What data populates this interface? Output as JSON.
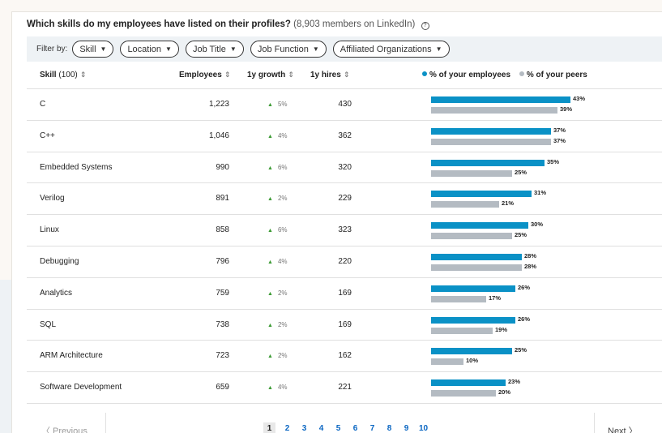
{
  "title": {
    "question": "Which skills do my employees have listed on their profiles?",
    "subtitle": "(8,903 members on LinkedIn)",
    "help_icon": "question-circle-icon"
  },
  "filters": {
    "label": "Filter by:",
    "pills": [
      "Skill",
      "Location",
      "Job Title",
      "Job Function",
      "Affiliated Organizations"
    ]
  },
  "columns": {
    "skill": "Skill",
    "skill_count": "(100)",
    "employees": "Employees",
    "growth": "1y growth",
    "hires": "1y hires",
    "legend_employees": "% of your employees",
    "legend_peers": "% of your peers"
  },
  "colors": {
    "employees_bar": "#0a91c6",
    "peers_bar": "#b4bbc2",
    "growth_up": "#3d9b35",
    "link": "#0a66c2"
  },
  "rows": [
    {
      "skill": "C",
      "employees": "1,223",
      "growth": "5%",
      "hires": "430",
      "emp_pct": 43,
      "peer_pct": 39,
      "emp_label": "43%",
      "peer_label": "39%"
    },
    {
      "skill": "C++",
      "employees": "1,046",
      "growth": "4%",
      "hires": "362",
      "emp_pct": 37,
      "peer_pct": 37,
      "emp_label": "37%",
      "peer_label": "37%"
    },
    {
      "skill": "Embedded Systems",
      "employees": "990",
      "growth": "6%",
      "hires": "320",
      "emp_pct": 35,
      "peer_pct": 25,
      "emp_label": "35%",
      "peer_label": "25%"
    },
    {
      "skill": "Verilog",
      "employees": "891",
      "growth": "2%",
      "hires": "229",
      "emp_pct": 31,
      "peer_pct": 21,
      "emp_label": "31%",
      "peer_label": "21%"
    },
    {
      "skill": "Linux",
      "employees": "858",
      "growth": "6%",
      "hires": "323",
      "emp_pct": 30,
      "peer_pct": 25,
      "emp_label": "30%",
      "peer_label": "25%"
    },
    {
      "skill": "Debugging",
      "employees": "796",
      "growth": "4%",
      "hires": "220",
      "emp_pct": 28,
      "peer_pct": 28,
      "emp_label": "28%",
      "peer_label": "28%"
    },
    {
      "skill": "Analytics",
      "employees": "759",
      "growth": "2%",
      "hires": "169",
      "emp_pct": 26,
      "peer_pct": 17,
      "emp_label": "26%",
      "peer_label": "17%"
    },
    {
      "skill": "SQL",
      "employees": "738",
      "growth": "2%",
      "hires": "169",
      "emp_pct": 26,
      "peer_pct": 19,
      "emp_label": "26%",
      "peer_label": "19%"
    },
    {
      "skill": "ARM Architecture",
      "employees": "723",
      "growth": "2%",
      "hires": "162",
      "emp_pct": 25,
      "peer_pct": 10,
      "emp_label": "25%",
      "peer_label": "10%"
    },
    {
      "skill": "Software Development",
      "employees": "659",
      "growth": "4%",
      "hires": "221",
      "emp_pct": 23,
      "peer_pct": 20,
      "emp_label": "23%",
      "peer_label": "20%"
    }
  ],
  "pagination": {
    "prev": "〈 Previous",
    "next": "Next 〉",
    "current": "1",
    "pages": [
      "1",
      "2",
      "3",
      "4",
      "5",
      "6",
      "7",
      "8",
      "9",
      "10"
    ]
  }
}
